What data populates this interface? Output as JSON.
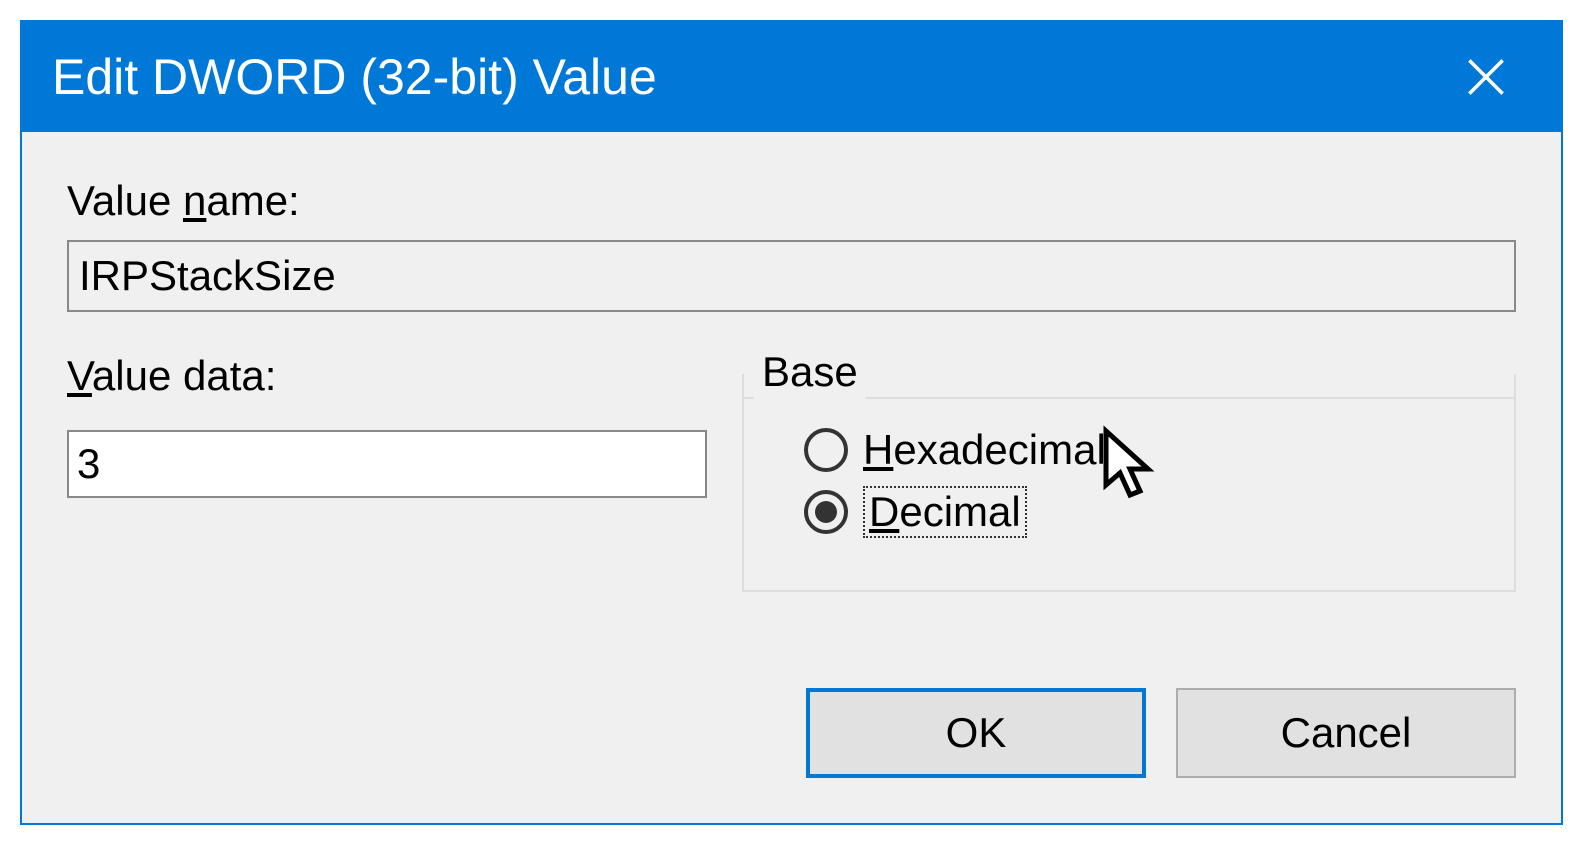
{
  "dialog": {
    "title": "Edit DWORD (32-bit) Value",
    "value_name_label_pre": "Value ",
    "value_name_label_u": "n",
    "value_name_label_post": "ame:",
    "value_name": "IRPStackSize",
    "value_data_label_u": "V",
    "value_data_label_post": "alue data:",
    "value_data": "3",
    "base_legend": "Base",
    "radio_hex_u": "H",
    "radio_hex_post": "exadecimal",
    "radio_dec_u": "D",
    "radio_dec_post": "ecimal",
    "ok_label": "OK",
    "cancel_label": "Cancel"
  }
}
